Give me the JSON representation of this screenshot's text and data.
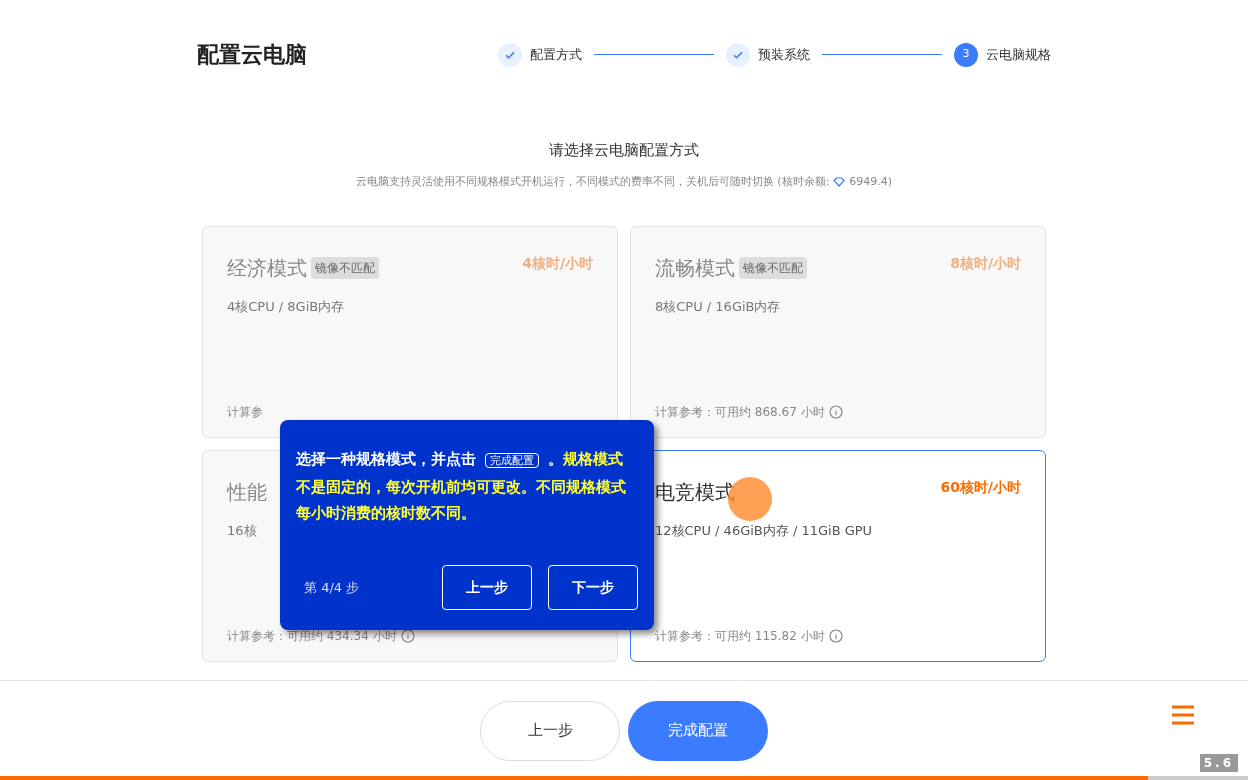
{
  "header": {
    "title": "配置云电脑"
  },
  "steps": [
    {
      "label": "配置方式",
      "done": true
    },
    {
      "label": "预装系统",
      "done": true
    },
    {
      "label": "云电脑规格",
      "done": false,
      "number": "3"
    }
  ],
  "intro": {
    "heading": "请选择云电脑配置方式",
    "note": "云电脑支持灵活使用不同规格模式开机运行，不同模式的费率不同，关机后可随时切换 (核时余额:",
    "balance": "6949.4)"
  },
  "cards": [
    {
      "name": "经济模式",
      "badge": "镜像不匹配",
      "rate": "4核时/小时",
      "spec": "4核CPU / 8GiB内存",
      "footer": "计算参",
      "disabled": true,
      "selected": false
    },
    {
      "name": "流畅模式",
      "badge": "镜像不匹配",
      "rate": "8核时/小时",
      "spec": "8核CPU / 16GiB内存",
      "footer": "计算参考：可用约 868.67 小时",
      "info": true,
      "disabled": true,
      "selected": false
    },
    {
      "name": "性能",
      "spec": "16核",
      "footer": "计算参考：可用约 434.34 小时",
      "info": true,
      "disabled": true,
      "selected": false
    },
    {
      "name": "电竞模式",
      "rate": "60核时/小时",
      "spec": "12核CPU / 46GiB内存 / 11GiB GPU",
      "footer": "计算参考：可用约 115.82 小时",
      "info": true,
      "disabled": false,
      "selected": true
    }
  ],
  "tour": {
    "lead": "选择一种规格模式，并点击",
    "chip": "完成配置",
    "after": "。",
    "highlight": "规格模式不是固定的，每次开机前均可更改。不同规格模式每小时消费的核时数不同。",
    "counter": "第 4/4 步",
    "buttons": [
      "上一步",
      "下一步"
    ]
  },
  "footer": {
    "buttons": [
      {
        "label": "上一步",
        "kind": "secondary"
      },
      {
        "label": "完成配置",
        "kind": "primary"
      }
    ],
    "version": "5.6",
    "progress": {
      "level": 0.92
    }
  }
}
